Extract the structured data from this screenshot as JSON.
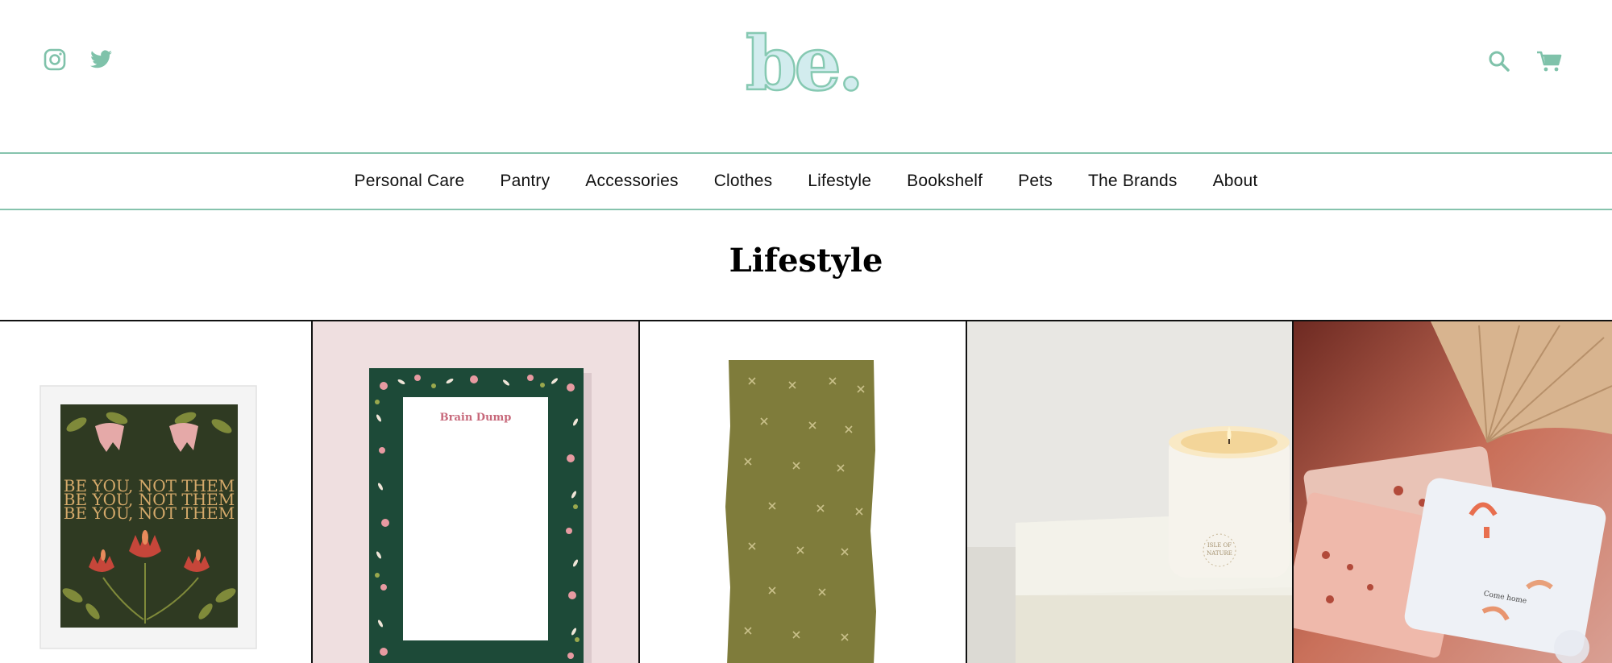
{
  "header": {
    "logo_text": "be.",
    "social": [
      "instagram-icon",
      "twitter-icon"
    ],
    "tools": [
      "search-icon",
      "cart-icon"
    ],
    "accent_color": "#86c3ad"
  },
  "nav": {
    "items": [
      {
        "label": "Personal Care"
      },
      {
        "label": "Pantry"
      },
      {
        "label": "Accessories"
      },
      {
        "label": "Clothes"
      },
      {
        "label": "Lifestyle"
      },
      {
        "label": "Bookshelf"
      },
      {
        "label": "Pets"
      },
      {
        "label": "The Brands"
      },
      {
        "label": "About"
      }
    ]
  },
  "page": {
    "title": "Lifestyle"
  },
  "products": [
    {
      "image_text": "BE YOU, NOT THEM"
    },
    {
      "image_text": "Brain Dump"
    },
    {
      "image_text": ""
    },
    {
      "image_text_line1": "ISLE OF",
      "image_text_line2": "NATURE"
    },
    {
      "image_text": "Come home"
    }
  ]
}
